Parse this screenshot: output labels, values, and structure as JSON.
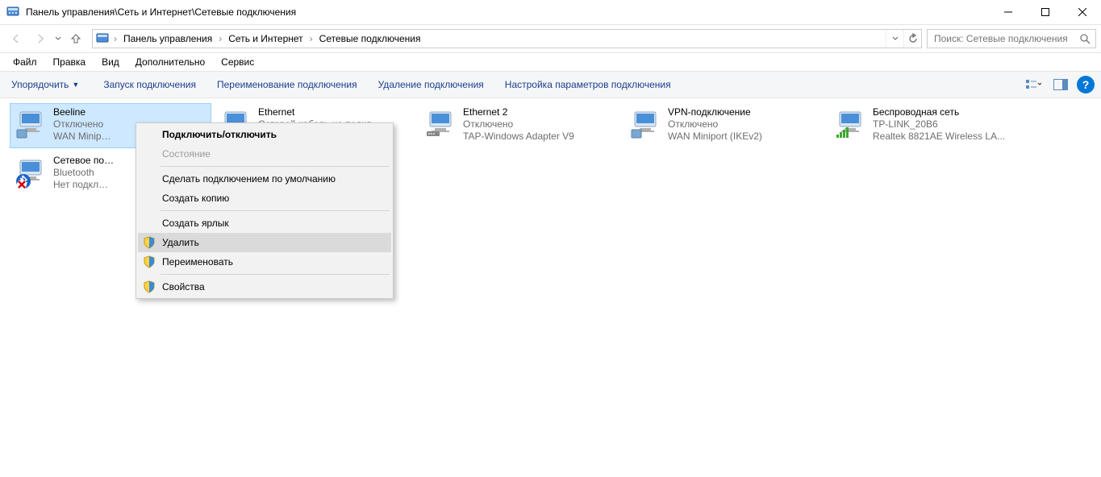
{
  "window": {
    "title": "Панель управления\\Сеть и Интернет\\Сетевые подключения"
  },
  "breadcrumb": {
    "items": [
      "Панель управления",
      "Сеть и Интернет",
      "Сетевые подключения"
    ]
  },
  "search": {
    "placeholder": "Поиск: Сетевые подключения"
  },
  "menubar": {
    "items": [
      "Файл",
      "Правка",
      "Вид",
      "Дополнительно",
      "Сервис"
    ]
  },
  "commandbar": {
    "organize": "Упорядочить",
    "items": [
      "Запуск подключения",
      "Переименование подключения",
      "Удаление подключения",
      "Настройка параметров подключения"
    ]
  },
  "connections": [
    {
      "name": "Beeline",
      "status": "Отключено",
      "device": "WAN Minip…",
      "icon": "wan",
      "selected": true,
      "overlay": null
    },
    {
      "name": "Ethernet",
      "status": "Сетевой кабель не подкл...",
      "device": "",
      "icon": "eth",
      "overlay": "x"
    },
    {
      "name": "Ethernet 2",
      "status": "Отключено",
      "device": "TAP-Windows Adapter V9",
      "icon": "eth",
      "overlay": null
    },
    {
      "name": "VPN-подключение",
      "status": "Отключено",
      "device": "WAN Miniport (IKEv2)",
      "icon": "wan",
      "overlay": null
    },
    {
      "name": "Беспроводная сеть",
      "status": "TP-LINK_20B6",
      "device": "Realtek 8821AE Wireless LA...",
      "icon": "wifi",
      "overlay": null
    },
    {
      "name": "Сетевое по…",
      "status": "Bluetooth",
      "device": "Нет подкл…",
      "icon": "bt",
      "overlay": "x"
    }
  ],
  "context_menu": {
    "items": [
      {
        "label": "Подключить/отключить",
        "bold": true
      },
      {
        "label": "Состояние",
        "disabled": true
      },
      {
        "sep": true
      },
      {
        "label": "Сделать подключением по умолчанию"
      },
      {
        "label": "Создать копию"
      },
      {
        "sep": true
      },
      {
        "label": "Создать ярлык"
      },
      {
        "label": "Удалить",
        "shield": true,
        "hover": true
      },
      {
        "label": "Переименовать",
        "shield": true
      },
      {
        "sep": true
      },
      {
        "label": "Свойства",
        "shield": true
      }
    ]
  },
  "help_label": "?"
}
